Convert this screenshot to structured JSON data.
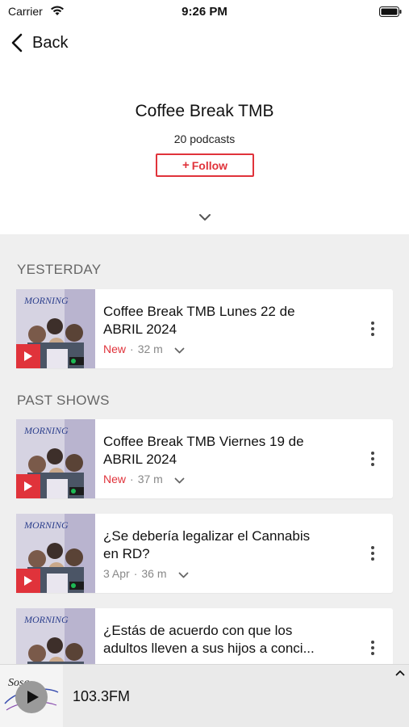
{
  "status_bar": {
    "carrier": "Carrier",
    "time": "9:26 PM"
  },
  "nav": {
    "back_label": "Back"
  },
  "header": {
    "title": "Coffee Break TMB",
    "podcast_count": "20 podcasts",
    "follow_label": "Follow"
  },
  "sections": {
    "yesterday": "YESTERDAY",
    "past_shows": "PAST SHOWS"
  },
  "episodes": [
    {
      "title_line1": "Coffee Break TMB Lunes 22 de",
      "title_line2": "ABRIL 2024",
      "badge": "New",
      "date": "",
      "duration": "32 m"
    },
    {
      "title_line1": "Coffee Break TMB Viernes 19 de",
      "title_line2": "ABRIL 2024",
      "badge": "New",
      "date": "",
      "duration": "37 m"
    },
    {
      "title_line1": "¿Se debería legalizar el Cannabis",
      "title_line2": "en RD?",
      "badge": "",
      "date": "3 Apr",
      "duration": "36 m"
    },
    {
      "title_line1": "¿Estás de acuerdo con que los",
      "title_line2": "adultos lleven a sus hijos a conci...",
      "badge": "",
      "date": "",
      "duration": ""
    }
  ],
  "artwork": {
    "caption": "MORNING"
  },
  "player": {
    "station": "103.3FM",
    "logo_text": "Sosa"
  },
  "colors": {
    "accent": "#e0333b",
    "background": "#efefef",
    "text": "#111111",
    "muted": "#888888"
  }
}
